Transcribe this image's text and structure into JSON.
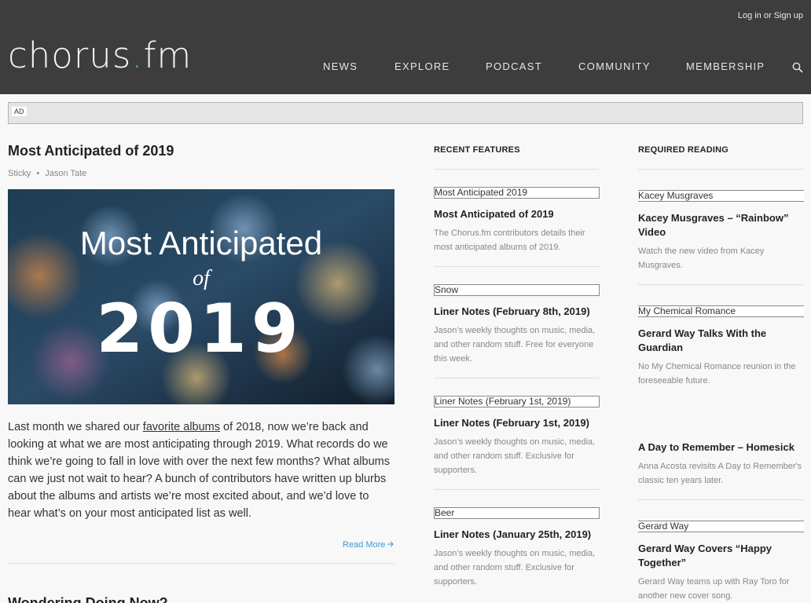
{
  "header": {
    "login_text": "Log in or Sign up",
    "logo": {
      "main": "chorus",
      "dot": ".",
      "suffix": "fm"
    },
    "nav": [
      "NEWS",
      "EXPLORE",
      "PODCAST",
      "COMMUNITY",
      "MEMBERSHIP"
    ],
    "search_icon": "search-icon"
  },
  "ad": {
    "tag": "AD"
  },
  "featured_post": {
    "title": "Most Anticipated of 2019",
    "meta": {
      "tag": "Sticky",
      "separator": "•",
      "author": "Jason Tate"
    },
    "image": {
      "line1": "Most Anticipated",
      "line2": "of",
      "line3": "2019"
    },
    "body_before_link": "Last month we shared our ",
    "body_link": "favorite albums",
    "body_after_link": " of 2018, now we’re back and looking at what we are most anticipating through 2019. What records do we think we’re going to fall in love with over the next few months? What albums can we just not wait to hear? A bunch of contributors have written up blurbs about the albums and artists we’re most excited about, and we’d love to hear what’s on your most anticipated list as well.",
    "read_more": "Read More"
  },
  "next_post": {
    "title": "Wondering Doing Now?"
  },
  "recent_features": {
    "heading": "RECENT FEATURES",
    "items": [
      {
        "thumb": "Most Anticipated 2019",
        "title": "Most Anticipated of 2019",
        "desc": "The Chorus.fm contributors details their most anticipated albums of 2019."
      },
      {
        "thumb": "Snow",
        "title": "Liner Notes (February 8th, 2019)",
        "desc": "Jason’s weekly thoughts on music, media, and other random stuff. Free for everyone this week."
      },
      {
        "thumb": "Liner Notes (February 1st, 2019)",
        "title": "Liner Notes (February 1st, 2019)",
        "desc": "Jason’s weekly thoughts on music, media, and other random stuff. Exclusive for supporters."
      },
      {
        "thumb": "Beer",
        "title": "Liner Notes (January 25th, 2019)",
        "desc": "Jason’s weekly thoughts on music, media, and other random stuff. Exclusive for supporters."
      }
    ]
  },
  "required_reading": {
    "heading": "REQUIRED READING",
    "items": [
      {
        "thumb": "Kacey Musgraves",
        "title": "Kacey Musgraves – “Rainbow” Video",
        "desc": "Watch the new video from Kacey Musgraves."
      },
      {
        "thumb": "My Chemical Romance",
        "title": "Gerard Way Talks With the Guardian",
        "desc": "No My Chemical Romance reunion in the foreseeable future."
      },
      {
        "thumb": "",
        "title": "A Day to Remember – Homesick",
        "desc": "Anna Acosta revisits A Day to Remember's classic ten years later."
      },
      {
        "thumb": "Gerard Way",
        "title": "Gerard Way Covers “Happy Together”",
        "desc": "Gerard Way teams up with Ray Toro for another new cover song."
      }
    ]
  },
  "colors": {
    "header_bg": "#3d3d3d",
    "accent": "#3aa7e6",
    "link": "#3a9bd8"
  }
}
